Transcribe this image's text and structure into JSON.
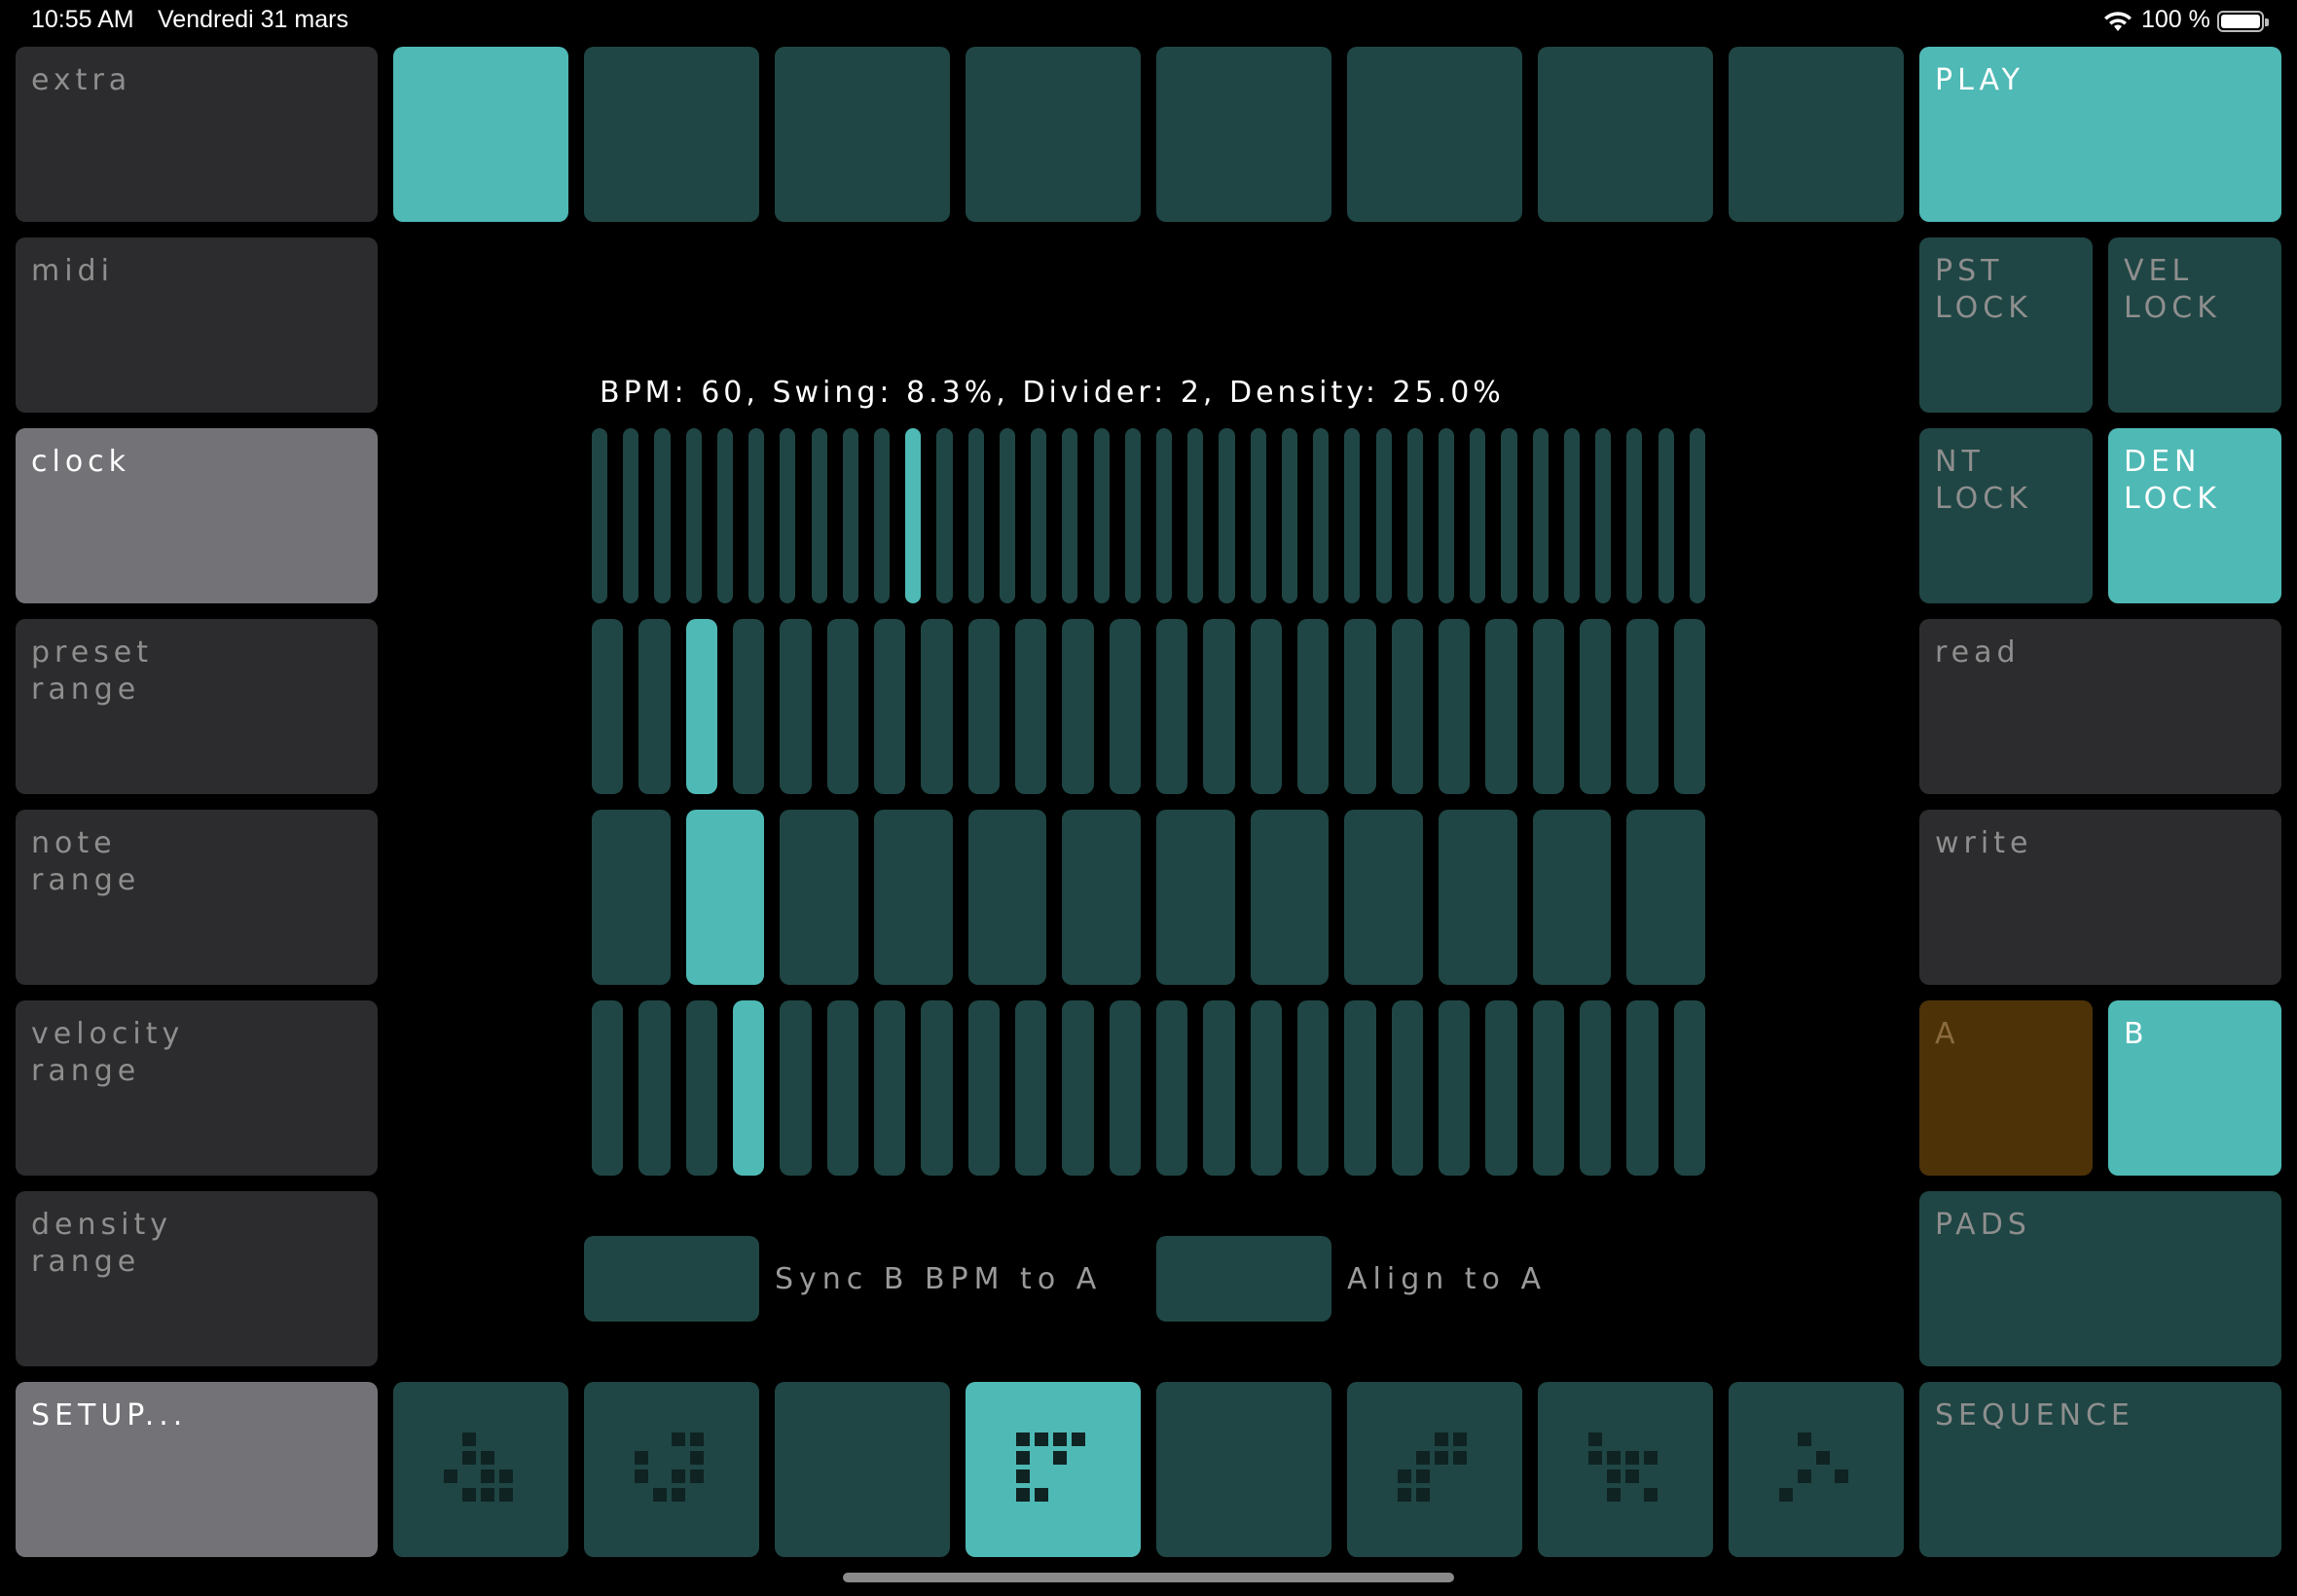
{
  "status_bar": {
    "time": "10:55 AM",
    "date": "Vendredi 31 mars",
    "battery_text": "100 %"
  },
  "left_menu": [
    {
      "label": "extra",
      "active": false
    },
    {
      "label": "midi",
      "active": false
    },
    {
      "label": "clock",
      "active": true
    },
    {
      "label": "preset\nrange",
      "active": false
    },
    {
      "label": "note\nrange",
      "active": false
    },
    {
      "label": "velocity\nrange",
      "active": false
    },
    {
      "label": "density\nrange",
      "active": false
    }
  ],
  "setup_button": "SETUP...",
  "play_button": "PLAY",
  "locks": [
    {
      "label": "PST\nLOCK",
      "active": false
    },
    {
      "label": "VEL\nLOCK",
      "active": false
    },
    {
      "label": "NT\nLOCK",
      "active": false
    },
    {
      "label": "DEN\nLOCK",
      "active": true
    }
  ],
  "read_button": "read",
  "write_button": "write",
  "track_a": "A",
  "track_b": "B",
  "pads_button": "PADS",
  "sequence_button": "SEQUENCE",
  "top_step_active_index": 0,
  "clock_info": "BPM: 60, Swing: 8.3%, Divider: 2, Density: 25.0%",
  "slider_rows": [
    {
      "name": "bpm",
      "count": 36,
      "selected": 10
    },
    {
      "name": "swing",
      "count": 24,
      "selected": 2
    },
    {
      "name": "divider",
      "count": 12,
      "selected": 1
    },
    {
      "name": "density",
      "count": 24,
      "selected": 3
    }
  ],
  "sync_label": "Sync B BPM to A",
  "align_label": "Align to A",
  "bottom_pads_active_index": 3,
  "colors": {
    "teal_dark": "#1f4644",
    "teal_bright": "#4fb9b5",
    "gray": "#2c2c2e",
    "gray_active": "#737277",
    "amber": "#4d3208"
  }
}
